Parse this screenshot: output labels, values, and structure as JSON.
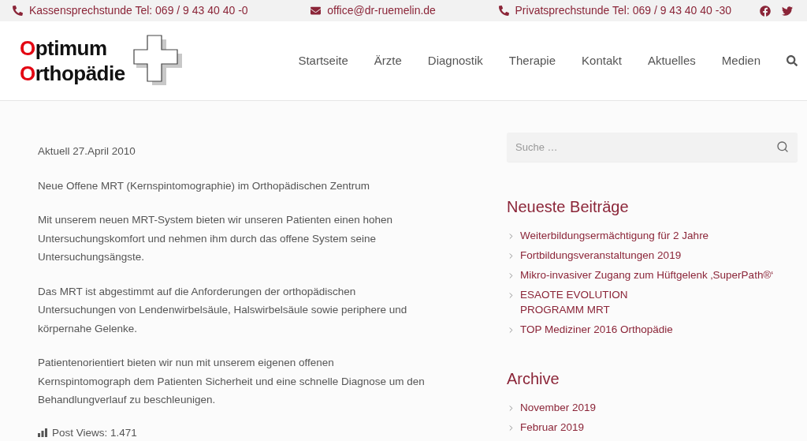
{
  "top_bar": {
    "items": [
      {
        "kind": "phone",
        "text": "Kassensprechstunde Tel: 069 / 9 43 40 40 -0"
      },
      {
        "kind": "mail",
        "text": "office@dr-ruemelin.de"
      },
      {
        "kind": "phone",
        "text": "Privatsprechstunde Tel: 069 / 9 43 40 40 -30"
      }
    ],
    "social": [
      {
        "kind": "facebook"
      },
      {
        "kind": "twitter"
      }
    ]
  },
  "logo": {
    "lines": [
      "Optimum",
      "Orthopädie"
    ]
  },
  "nav": {
    "items": [
      {
        "label": "Startseite",
        "selected": false
      },
      {
        "label": "Ärzte",
        "selected": false
      },
      {
        "label": "Diagnostik",
        "selected": false
      },
      {
        "label": "Therapie",
        "selected": false
      },
      {
        "label": "Kontakt",
        "selected": false
      },
      {
        "label": "Aktuelles",
        "selected": false
      },
      {
        "label": "Medien",
        "selected": false
      }
    ]
  },
  "article": {
    "paragraphs": [
      "Aktuell 27.April 2010",
      "Neue Offene MRT (Kernspintomographie) im Orthopädischen Zentrum",
      "Mit unserem neuen MRT-System bieten wir unseren Patienten einen hohen\nUntersuchungskomfort und nehmen ihm durch das offene System seine\nUntersuchungsängste.",
      "Das MRT ist abgestimmt auf die Anforderungen der orthopädischen\nUntersuchungen von Lendenwirbelsäule, Halswirbelsäule sowie periphere und\nkörpernahe Gelenke.",
      "Patientenorientiert bieten wir nun mit unserem eigenen offenen\nKernspintomograph dem Patienten Sicherheit und eine schnelle Diagnose um den\nBehandlungverlauf zu beschleunigen."
    ],
    "views": "Post Views: 1.471"
  },
  "sidebar": {
    "search": {
      "placeholder": "Suche …"
    },
    "widgets": [
      {
        "title": "Neueste Beiträge",
        "items": [
          "Weiterbildungsermächtigung für 2 Jahre",
          "Fortbildungsveranstaltungen 2019",
          "Mikro-invasiver Zugang zum Hüftgelenk ‚SuperPath®‘",
          "ESAOTE EVOLUTION\nPROGRAMM MRT",
          "TOP Mediziner 2016 Orthopädie"
        ]
      },
      {
        "title": "Archive",
        "items": [
          "November 2019",
          "Februar 2019"
        ]
      }
    ]
  }
}
